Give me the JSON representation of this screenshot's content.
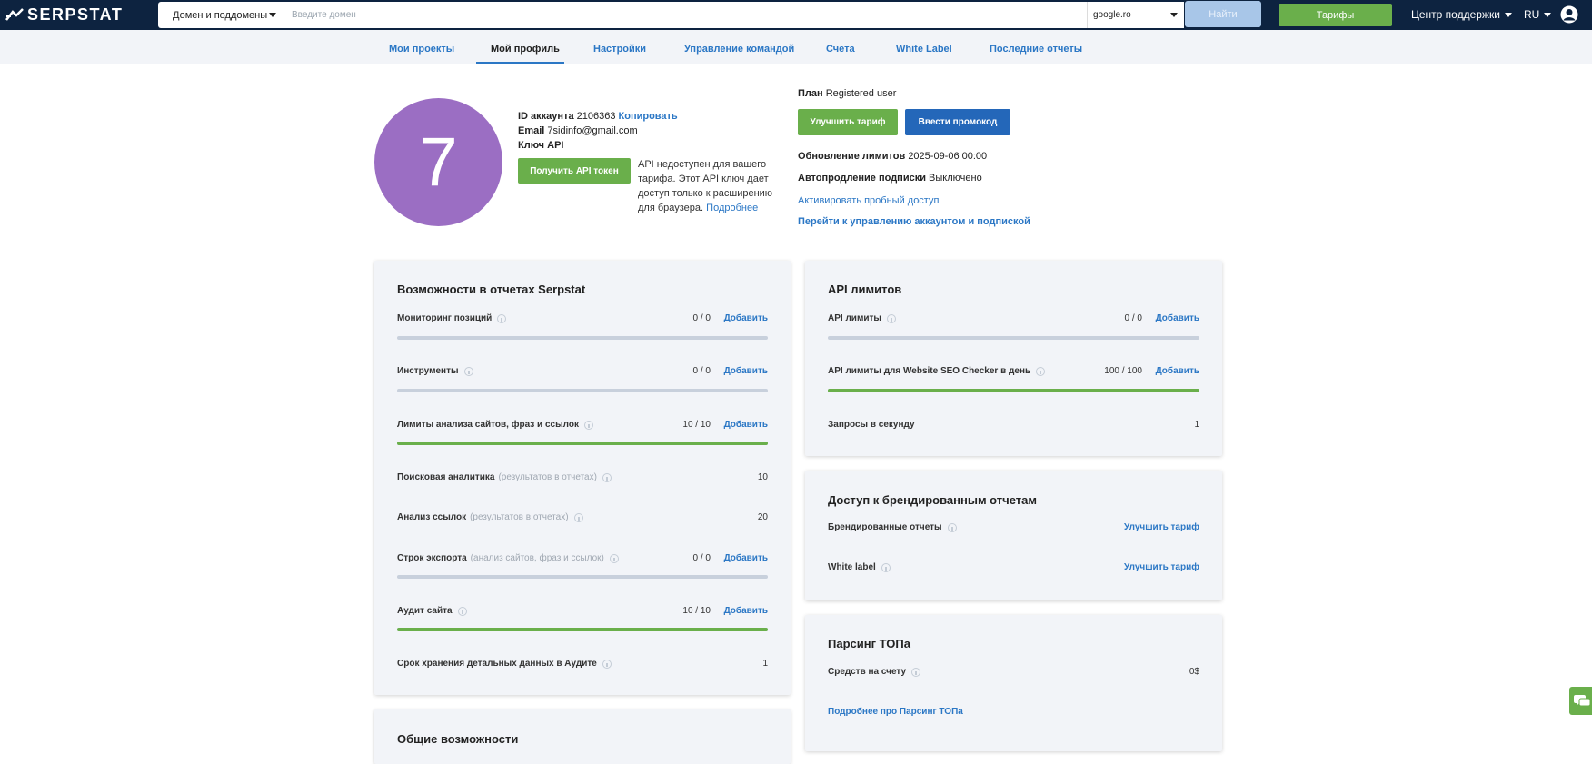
{
  "header": {
    "logo": "SERPSTAT",
    "domain_type": "Домен и поддомены",
    "search_placeholder": "Введите домен",
    "engine": "google.ro",
    "find": "Найти",
    "tariffs": "Тарифы",
    "support": "Центр поддержки",
    "lang": "RU"
  },
  "nav": [
    "Мои проекты",
    "Мой профиль",
    "Настройки",
    "Управление командой",
    "Счета",
    "White Label",
    "Последние отчеты"
  ],
  "nav_active": "Мой профиль",
  "profile": {
    "avatar_letter": "7",
    "id_label": "ID аккаунта",
    "id_value": "2106363",
    "copy": "Копировать",
    "email_label": "Email",
    "email_value": "7sidinfo@gmail.com",
    "api_key_label": "Ключ API",
    "get_token": "Получить API токен",
    "api_note": "API недоступен для вашего тарифа. Этот API ключ дает доступ только к расширению для браузера.",
    "api_more": "Подробнее"
  },
  "plan": {
    "label": "План",
    "value": "Registered user",
    "upgrade": "Улучшить тариф",
    "promo": "Ввести промокод",
    "limits_label": "Обновление лимитов",
    "limits_value": "2025-09-06 00:00",
    "autorenew_label": "Автопродление подписки",
    "autorenew_value": "Выключено",
    "trial": "Активировать пробный доступ",
    "manage": "Перейти к управлению аккаунтом и подпиской"
  },
  "reports": {
    "title": "Возможности в отчетах Serpstat",
    "rows": [
      {
        "label": "Мониторинг позиций",
        "value": "0 / 0",
        "action": "Добавить",
        "fill": 0
      },
      {
        "label": "Инструменты",
        "value": "0 / 0",
        "action": "Добавить",
        "fill": 0
      },
      {
        "label": "Лимиты анализа сайтов, фраз и ссылок",
        "value": "10 / 10",
        "action": "Добавить",
        "fill": 1
      },
      {
        "label": "Поисковая аналитика",
        "sub": "(результатов в отчетах)",
        "value": "10"
      },
      {
        "label": "Анализ ссылок",
        "sub": "(результатов в отчетах)",
        "value": "20"
      },
      {
        "label": "Строк экспорта",
        "sub": "(анализ сайтов, фраз и ссылок)",
        "value": "0 / 0",
        "action": "Добавить",
        "fill": 0
      },
      {
        "label": "Аудит сайта",
        "value": "10 / 10",
        "action": "Добавить",
        "fill": 1
      },
      {
        "label": "Срок хранения детальных данных в Аудите",
        "value": "1"
      }
    ]
  },
  "api": {
    "title": "API лимитов",
    "rows": [
      {
        "label": "API лимиты",
        "value": "0 / 0",
        "action": "Добавить",
        "fill": 0
      },
      {
        "label": "API лимиты для Website SEO Checker в день",
        "value": "100 / 100",
        "action": "Добавить",
        "fill": 1
      },
      {
        "label": "Запросы в секунду",
        "value": "1"
      }
    ]
  },
  "branded": {
    "title": "Доступ к брендированным отчетам",
    "rows": [
      {
        "label": "Брендированные отчеты",
        "action": "Улучшить тариф"
      },
      {
        "label": "White label",
        "action": "Улучшить тариф"
      }
    ]
  },
  "parsing": {
    "title": "Парсинг ТОПа",
    "balance_label": "Средств на счету",
    "balance_value": "0$",
    "more": "Подробнее про Парсинг ТОПа"
  },
  "general": {
    "title": "Общие возможности"
  },
  "colors": {
    "navy": "#0d2340",
    "green": "#6aaf4b",
    "blue": "#2467b9",
    "link": "#2b77c5",
    "avatar": "#9b6ec3"
  }
}
